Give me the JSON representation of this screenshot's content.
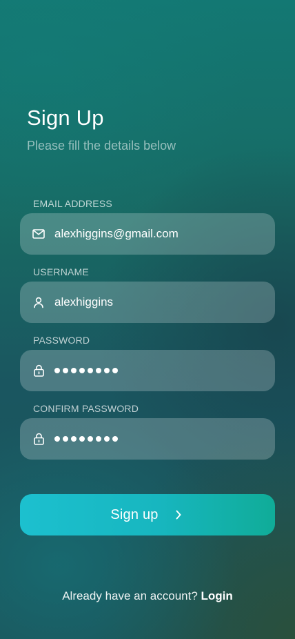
{
  "header": {
    "title": "Sign Up",
    "subtitle": "Please fill the details below"
  },
  "form": {
    "email": {
      "label": "EMAIL ADDRESS",
      "value": "alexhiggins@gmail.com",
      "icon": "mail-icon"
    },
    "username": {
      "label": "USERNAME",
      "value": "alexhiggins",
      "icon": "user-icon"
    },
    "password": {
      "label": "PASSWORD",
      "masked_length": 8,
      "icon": "lock-icon"
    },
    "confirm_password": {
      "label": "CONFIRM PASSWORD",
      "masked_length": 8,
      "icon": "lock-icon"
    }
  },
  "actions": {
    "signup_label": "Sign up",
    "signup_icon": "chevron-right-icon"
  },
  "footer": {
    "prompt": "Already have an account?",
    "login_label": "Login"
  },
  "colors": {
    "background_top": "#137873",
    "background_bottom": "#2b503a",
    "button_start": "#1cc0cf",
    "button_end": "#10ac98",
    "field_fill": "rgba(255,255,255,0.22)"
  }
}
